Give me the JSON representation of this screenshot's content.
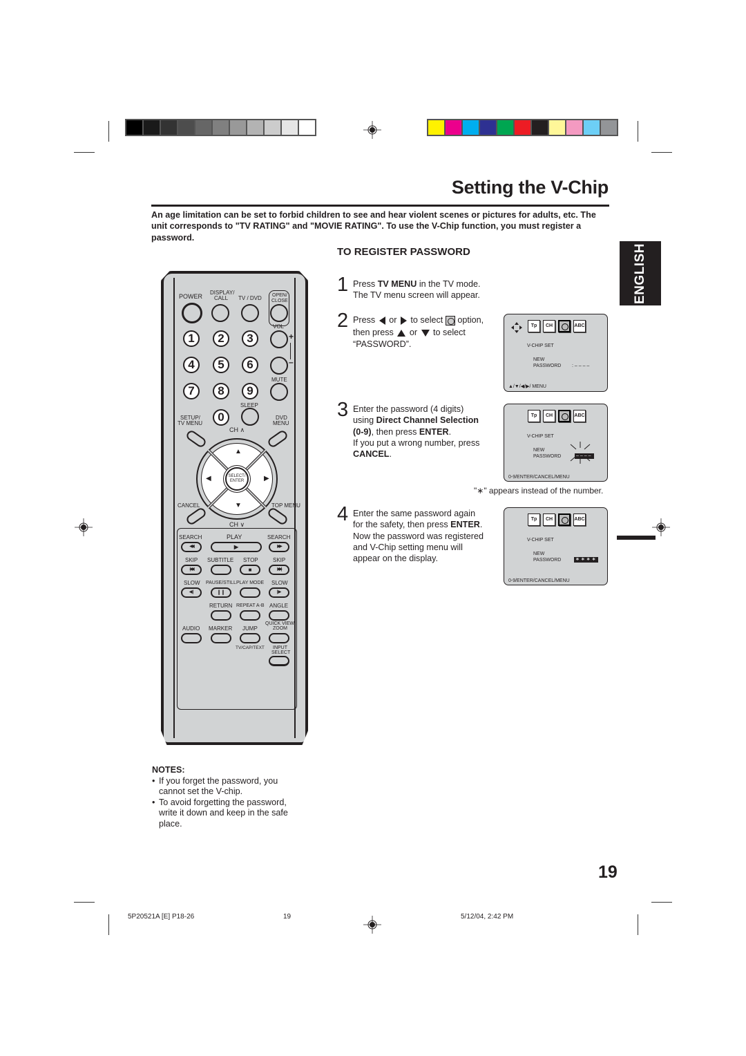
{
  "colors": {
    "gray_scale": [
      "#000000",
      "#1a1a1a",
      "#333333",
      "#4d4d4d",
      "#666666",
      "#808080",
      "#999999",
      "#b3b3b3",
      "#cccccc",
      "#e6e6e6",
      "#ffffff"
    ],
    "process_colors": [
      "#fff200",
      "#ec008c",
      "#00aeef",
      "#2e3192",
      "#00a651",
      "#ed1c24",
      "#231f20",
      "#fff799",
      "#f49ac1",
      "#6dcff6",
      "#939598"
    ],
    "remote_body": "#d1d3d4",
    "text": "#231f20"
  },
  "page": {
    "title": "Setting the V-Chip",
    "intro": "An age limitation can be set to forbid children to see and hear violent scenes or pictures for adults, etc. The unit corresponds to \"TV RATING\" and \"MOVIE RATING\". To use the V-Chip function, you must register a password.",
    "language_tab": "ENGLISH",
    "page_number": "19"
  },
  "section": {
    "title": "TO REGISTER PASSWORD",
    "steps": [
      {
        "number": "1",
        "lines": [
          "Press |TV MENU| in the TV mode.",
          "The TV menu screen will appear."
        ]
      },
      {
        "number": "2",
        "line1_a": "Press",
        "line1_b": "or",
        "line1_c": "to select",
        "line1_d": "option,",
        "line2_a": "then press",
        "line2_b": "or",
        "line2_c": "to select",
        "line3": "“PASSWORD”."
      },
      {
        "number": "3",
        "line1": "Enter the password (4 digits)",
        "line2_a": "using ",
        "line2_b": "Direct Channel Selection",
        "line3_a": "(0-9)",
        "line3_b": ", then press ",
        "line3_c": "ENTER",
        "line3_d": ".",
        "line4": "If you put a wrong number, press",
        "line5_a": "CANCEL",
        "line5_b": "."
      },
      {
        "number": "4",
        "line1": "Enter the same password again",
        "line2_a": "for the safety, then press ",
        "line2_b": "ENTER",
        "line2_c": ".",
        "line3": "Now the password was registered",
        "line4": "and V-Chip setting menu will",
        "line5": "appear on the display."
      }
    ],
    "star_note": "\"∗\" appears instead of the number."
  },
  "screens": [
    {
      "heading": "V-CHIP  SET",
      "field_label_1": "NEW",
      "field_label_2": "PASSWORD",
      "value": ": – – – –",
      "nav_hint": "▲/▼/◀/▶/ MENU",
      "menu_icons": [
        "Tp",
        "CH",
        "V-Chip",
        "ABC"
      ]
    },
    {
      "heading": "V-CHIP  SET",
      "field_label_1": "NEW",
      "field_label_2": "PASSWORD",
      "value": "––––",
      "nav_hint": "0-9/ENTER/CANCEL/MENU",
      "menu_icons": [
        "Tp",
        "CH",
        "V-Chip",
        "ABC"
      ]
    },
    {
      "heading": "V-CHIP  SET",
      "field_label_1": "NEW",
      "field_label_2": "PASSWORD",
      "value": "∗∗∗∗",
      "nav_hint": "0-9/ENTER/CANCEL/MENU",
      "menu_icons": [
        "Tp",
        "CH",
        "V-Chip",
        "ABC"
      ]
    }
  ],
  "remote": {
    "power": "POWER",
    "display_call": "DISPLAY/\nCALL",
    "display_1": "DISPLAY/",
    "display_2": "CALL",
    "tv_dvd": "TV / DVD",
    "open_close_1": "OPEN/",
    "open_close_2": "CLOSE",
    "vol": "VOL",
    "vol_plus": "+",
    "vol_minus": "–",
    "mute": "MUTE",
    "sleep": "SLEEP",
    "digits": [
      "1",
      "2",
      "3",
      "4",
      "5",
      "6",
      "7",
      "8",
      "9",
      "0"
    ],
    "setup_1": "SETUP/",
    "setup_2": "TV MENU",
    "dvd_menu_1": "DVD",
    "dvd_menu_2": "MENU",
    "ch_up": "CH ∧",
    "ch_down": "CH ∨",
    "select_1": "SELECT/",
    "select_2": "ENTER",
    "cancel": "CANCEL",
    "top_menu": "TOP MENU",
    "search_l": "SEARCH",
    "play": "PLAY",
    "search_r": "SEARCH",
    "skip_l": "SKIP",
    "subtitle": "SUBTITLE",
    "stop": "STOP",
    "skip_r": "SKIP",
    "slow_l": "SLOW",
    "pause_still": "PAUSE/STILL",
    "play_mode": "PLAY MODE",
    "slow_r": "SLOW",
    "return": "RETURN",
    "repeat_ab": "REPEAT A-B",
    "angle": "ANGLE",
    "audio": "AUDIO",
    "marker": "MARKER",
    "jump": "JUMP",
    "quick_view_1": "QUICK VIEW/",
    "quick_view_2": "ZOOM",
    "tv_cap_text": "TV/CAP/TEXT",
    "input_select_1": "INPUT",
    "input_select_2": "SELECT",
    "glyphs": {
      "search_back": "◀◀",
      "play": "▶",
      "search_fwd": "▶▶",
      "skip_back": "|◀◀",
      "stop": "■",
      "skip_fwd": "▶▶|",
      "slow_back": "◀|",
      "pause": "❙❙",
      "slow_fwd": "|▶",
      "up": "▲",
      "down": "▼",
      "left": "◀",
      "right": "▶"
    }
  },
  "notes": {
    "heading": "NOTES:",
    "items": [
      "If you forget the password, you cannot set the V-chip.",
      "To avoid forgetting the password, write it down and keep in the safe place."
    ]
  },
  "footer": {
    "doc_code": "5P20521A [E] P18-26",
    "sheet": "19",
    "timestamp": "5/12/04, 2:42 PM"
  }
}
